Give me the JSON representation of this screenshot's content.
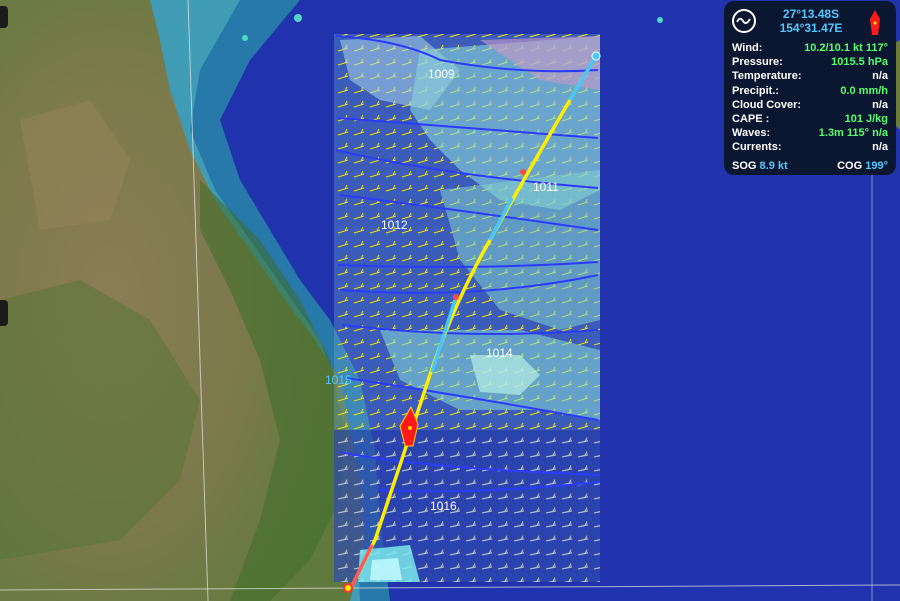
{
  "map": {
    "isobars": [
      "1009",
      "1011",
      "1012",
      "1014",
      "1015",
      "1016"
    ]
  },
  "panel": {
    "lat": "27°13.48S",
    "lon": "154°31.47E",
    "rows": [
      {
        "label": "Wind:",
        "value": "10.2/10.1 kt 117°",
        "na": false
      },
      {
        "label": "Pressure:",
        "value": "1015.5 hPa",
        "na": false
      },
      {
        "label": "Temperature:",
        "value": "n/a",
        "na": true
      },
      {
        "label": "Precipit.:",
        "value": "0.0 mm/h",
        "na": false
      },
      {
        "label": "Cloud Cover:",
        "value": "n/a",
        "na": true
      },
      {
        "label": "CAPE :",
        "value": "101 J/kg",
        "na": false
      },
      {
        "label": "Waves:",
        "value": "1.3m 115° n/a",
        "na": false
      },
      {
        "label": "Currents:",
        "value": "n/a",
        "na": true
      }
    ],
    "sog_label": "SOG",
    "sog_value": "8.9 kt",
    "cog_label": "COG",
    "cog_value": "199°"
  },
  "colors": {
    "ocean": "#1d2fa6",
    "route": "#ffee00",
    "route_alt": "#45c8ff",
    "boat": "#ff1a1a",
    "isobar": "#2a3cff",
    "wind_barb": "#f0e000",
    "panel_bg": "#0b1630",
    "panel_value": "#56ff6c",
    "panel_coord": "#53c8ff"
  },
  "icons": {
    "mode": "trend-wave-icon",
    "boat": "boat-icon"
  }
}
